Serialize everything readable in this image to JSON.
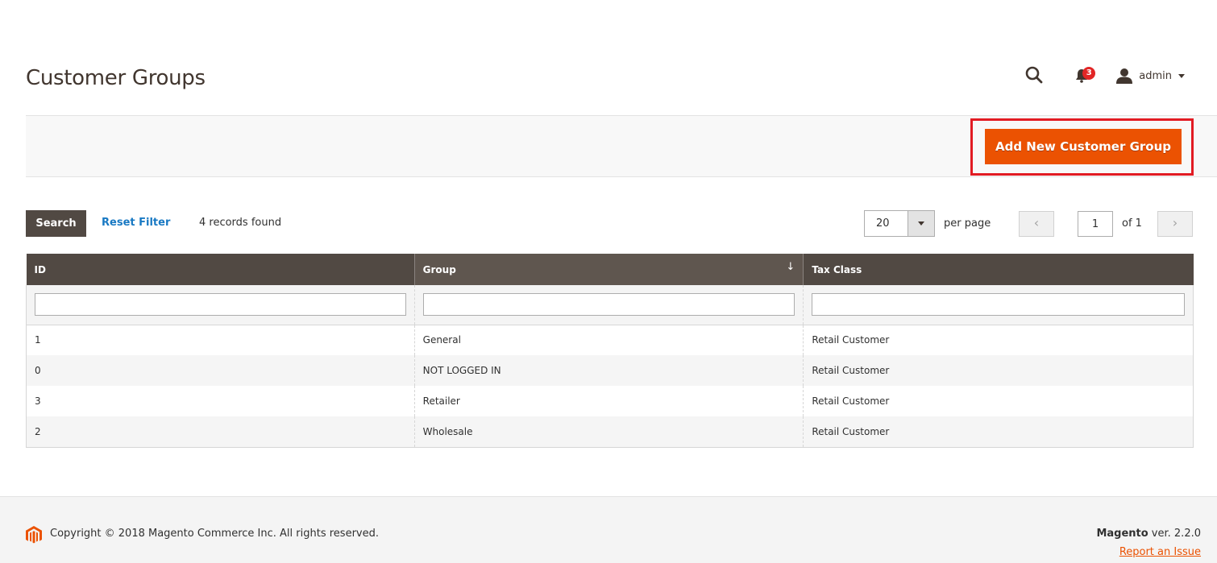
{
  "page": {
    "title": "Customer Groups"
  },
  "header": {
    "notification_count": "3",
    "user_name": "admin"
  },
  "actions": {
    "add_new_label": "Add New Customer Group",
    "accent_color": "#eb5202",
    "highlight_color": "#e21b23"
  },
  "toolbar": {
    "search_label": "Search",
    "reset_filter_label": "Reset Filter",
    "records_found": "4 records found",
    "per_page_value": "20",
    "per_page_label": "per page",
    "current_page": "1",
    "page_of": "of 1",
    "prev_icon": "‹",
    "next_icon": "›"
  },
  "grid": {
    "columns": [
      {
        "label": "ID"
      },
      {
        "label": "Group",
        "sort_icon": "↓"
      },
      {
        "label": "Tax Class"
      }
    ],
    "rows": [
      {
        "id": "1",
        "group": "General",
        "tax_class": "Retail Customer"
      },
      {
        "id": "0",
        "group": "NOT LOGGED IN",
        "tax_class": "Retail Customer"
      },
      {
        "id": "3",
        "group": "Retailer",
        "tax_class": "Retail Customer"
      },
      {
        "id": "2",
        "group": "Wholesale",
        "tax_class": "Retail Customer"
      }
    ]
  },
  "footer": {
    "copyright": "Copyright © 2018 Magento Commerce Inc. All rights reserved.",
    "brand": "Magento",
    "version": " ver. 2.2.0",
    "report_issue": "Report an Issue"
  }
}
